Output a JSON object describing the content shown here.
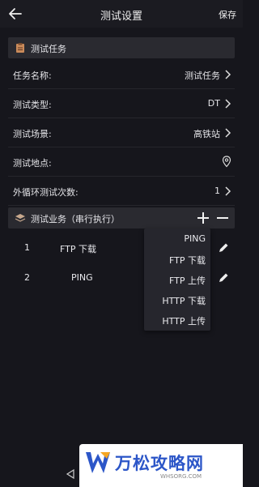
{
  "header": {
    "title": "测试设置",
    "save_label": "保存"
  },
  "task_section": {
    "title": "测试任务"
  },
  "rows": [
    {
      "label": "任务名称:",
      "value": "测试任务"
    },
    {
      "label": "测试类型:",
      "value": "DT"
    },
    {
      "label": "测试场景:",
      "value": "高铁站"
    },
    {
      "label": "测试地点:",
      "value": ""
    },
    {
      "label": "外循环测试次数:",
      "value": "1"
    }
  ],
  "business_section": {
    "title": "测试业务（串行执行）"
  },
  "tasks": [
    {
      "num": "1",
      "name": "FTP 下载"
    },
    {
      "num": "2",
      "name": "PING"
    }
  ],
  "dropdown_options": [
    "PING",
    "FTP 下载",
    "FTP 上传",
    "HTTP 下载",
    "HTTP 上传"
  ],
  "watermark": {
    "text": "万松攻略网",
    "url": "WHSORG.COM"
  },
  "colors": {
    "background": "#16161c",
    "section": "#2a2a30",
    "dropdown": "#26262d",
    "watermark_blue": "#2c56c8"
  }
}
